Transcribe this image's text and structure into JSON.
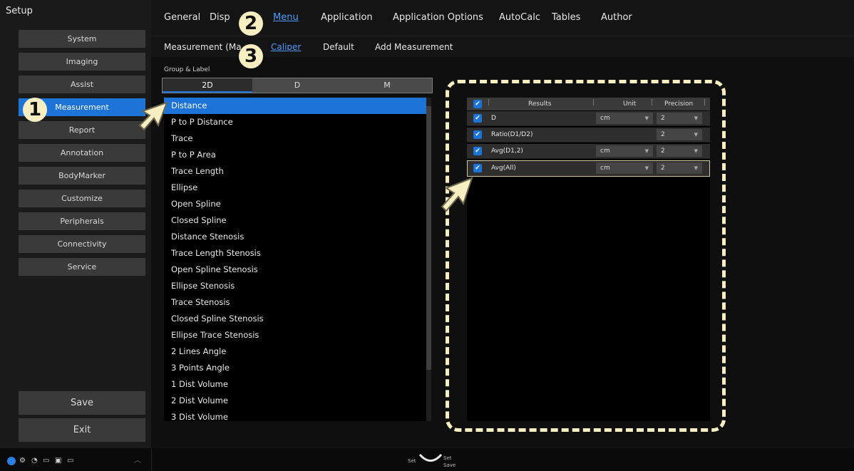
{
  "sidebar": {
    "title": "Setup",
    "items": [
      "System",
      "Imaging",
      "Assist",
      "Measurement",
      "Report",
      "Annotation",
      "BodyMarker",
      "Customize",
      "Peripherals",
      "Connectivity",
      "Service"
    ],
    "save": "Save",
    "exit": "Exit"
  },
  "tabs": [
    "General",
    "Disp",
    "Menu",
    "Application",
    "Application Options",
    "AutoCalc",
    "Tables",
    "Author"
  ],
  "subtabs": [
    "Measurement (Ma",
    "Caliper",
    "Default",
    "Add Measurement"
  ],
  "group_label": "Group & Label",
  "segments": [
    "2D",
    "D",
    "M"
  ],
  "measurements": [
    "Distance",
    "P to P Distance",
    "Trace",
    "P to P Area",
    "Trace Length",
    "Ellipse",
    "Open Spline",
    "Closed Spline",
    "Distance Stenosis",
    "Trace Length Stenosis",
    "Open Spline Stenosis",
    "Ellipse Stenosis",
    "Trace Stenosis",
    "Closed Spline Stenosis",
    "Ellipse Trace Stenosis",
    "2 Lines Angle",
    "3 Points Angle",
    "1 Dist Volume",
    "2 Dist Volume",
    "3 Dist Volume"
  ],
  "results": {
    "headers": [
      "Results",
      "Unit",
      "Precision"
    ],
    "rows": [
      {
        "name": "D",
        "unit": "cm",
        "precision": "2"
      },
      {
        "name": "Ratio(D1/D2)",
        "unit": "",
        "precision": "2"
      },
      {
        "name": "Avg(D1,2)",
        "unit": "cm",
        "precision": "2"
      },
      {
        "name": "Avg(All)",
        "unit": "cm",
        "precision": "2"
      }
    ]
  },
  "badges": [
    "1",
    "2",
    "3"
  ],
  "status": {
    "set_left": "Set",
    "set_right": "Set",
    "save_small": "Save"
  },
  "colors": {
    "accent": "#1e73d6",
    "badge": "#f7efc2",
    "active_tab": "#4d9cff"
  }
}
